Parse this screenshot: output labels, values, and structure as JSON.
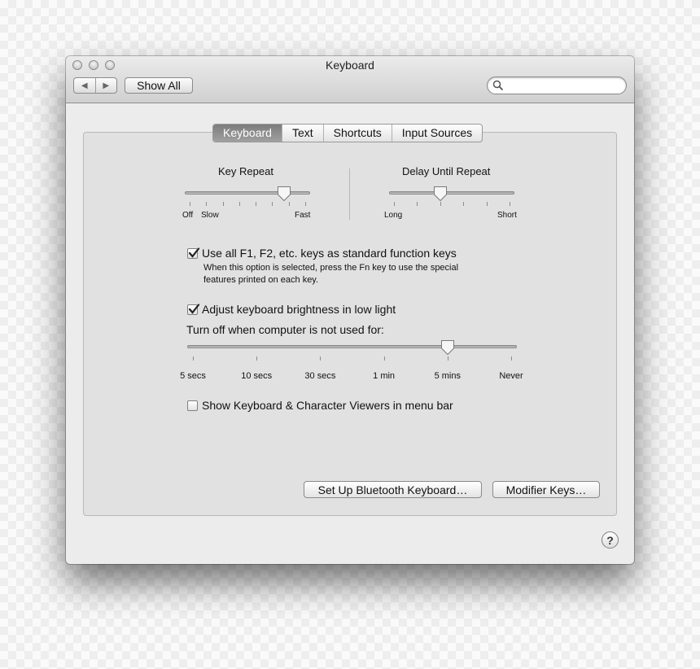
{
  "window": {
    "title": "Keyboard"
  },
  "toolbar": {
    "back_glyph": "◀",
    "forward_glyph": "▶",
    "show_all_label": "Show All",
    "search_placeholder": ""
  },
  "tabs": [
    {
      "label": "Keyboard",
      "selected": true
    },
    {
      "label": "Text",
      "selected": false
    },
    {
      "label": "Shortcuts",
      "selected": false
    },
    {
      "label": "Input Sources",
      "selected": false
    }
  ],
  "key_repeat": {
    "title": "Key Repeat",
    "label_off": "Off",
    "label_slow": "Slow",
    "label_fast": "Fast",
    "value": 0.82
  },
  "delay_until_repeat": {
    "title": "Delay Until Repeat",
    "label_long": "Long",
    "label_short": "Short",
    "value": 0.4
  },
  "fn_keys": {
    "label": "Use all F1, F2, etc. keys as standard function keys",
    "checked": true,
    "description_line1": "When this option is selected, press the Fn key to use the special",
    "description_line2": "features printed on each key."
  },
  "brightness": {
    "label": "Adjust keyboard brightness in low light",
    "checked": true
  },
  "turn_off": {
    "label": "Turn off when computer is not used for:",
    "ticks": [
      "5 secs",
      "10 secs",
      "30 secs",
      "1 min",
      "5 mins",
      "Never"
    ],
    "value": "5 mins"
  },
  "viewers": {
    "label": "Show Keyboard & Character Viewers in menu bar",
    "checked": false
  },
  "buttons": {
    "bluetooth": "Set Up Bluetooth Keyboard…",
    "modifier": "Modifier Keys…",
    "help": "?"
  },
  "colors": {
    "window_bg": "#ececec",
    "panel_bg": "#e1e1e1",
    "selected_tab": "#8a8a8a"
  }
}
